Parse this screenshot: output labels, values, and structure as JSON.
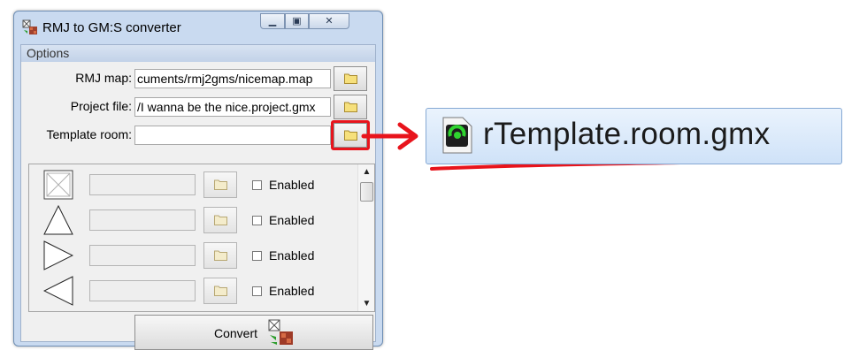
{
  "window": {
    "title": "RMJ to GM:S converter",
    "controls": {
      "minimize": "minimize",
      "maximize": "maximize",
      "close": "close"
    }
  },
  "options": {
    "header": "Options",
    "rmj_map": {
      "label": "RMJ map:",
      "value": "cuments/rmj2gms/nicemap.map"
    },
    "project_file": {
      "label": "Project file:",
      "value": "/I wanna be the nice.project.gmx"
    },
    "template_room": {
      "label": "Template room:",
      "value": ""
    }
  },
  "object_rows": [
    {
      "shape": "block-icon",
      "field": "",
      "enabled_label": "Enabled",
      "checked": false
    },
    {
      "shape": "triangle-up-icon",
      "field": "",
      "enabled_label": "Enabled",
      "checked": false
    },
    {
      "shape": "triangle-right-icon",
      "field": "",
      "enabled_label": "Enabled",
      "checked": false
    },
    {
      "shape": "triangle-left-icon",
      "field": "",
      "enabled_label": "Enabled",
      "checked": false
    }
  ],
  "convert": {
    "label": "Convert"
  },
  "annotation": {
    "file_name": "rTemplate.room.gmx",
    "highlight_color": "#e8141c"
  }
}
